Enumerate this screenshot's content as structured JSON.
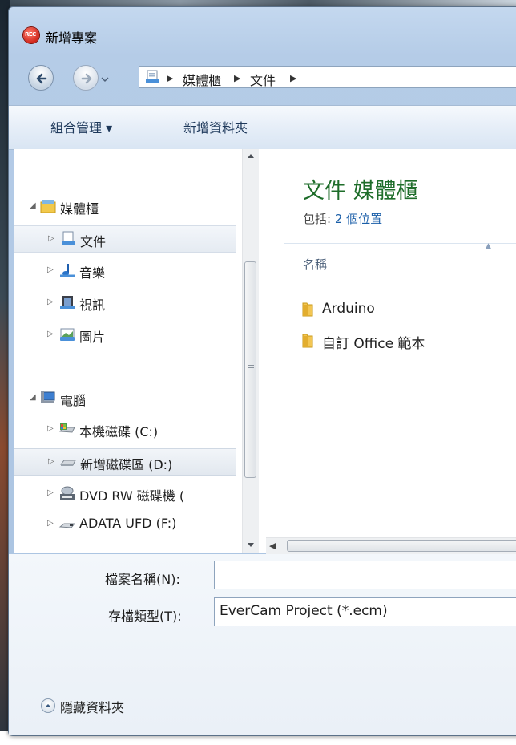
{
  "window": {
    "title": "新增專案",
    "app_badge": "REC"
  },
  "address": {
    "segments": [
      "媒體櫃",
      "文件"
    ]
  },
  "toolbar": {
    "organize": "組合管理 ▾",
    "new_folder": "新增資料夾"
  },
  "nav": {
    "items": [
      {
        "label": "媒體櫃",
        "icon": "library-icon"
      },
      {
        "label": "文件",
        "icon": "documents-icon"
      },
      {
        "label": "音樂",
        "icon": "music-icon"
      },
      {
        "label": "視訊",
        "icon": "video-icon"
      },
      {
        "label": "圖片",
        "icon": "pictures-icon"
      },
      {
        "label": "電腦",
        "icon": "computer-icon"
      },
      {
        "label": "本機磁碟 (C:)",
        "icon": "drive-icon"
      },
      {
        "label": "新增磁碟區 (D:)",
        "icon": "drive-icon"
      },
      {
        "label": "DVD RW 磁碟機 (",
        "icon": "dvd-icon"
      },
      {
        "label": "ADATA UFD (F:)",
        "icon": "usb-drive-icon"
      }
    ]
  },
  "library": {
    "title": "文件 媒體櫃",
    "includes_prefix": "包括: ",
    "includes_link": "2 個位置",
    "column_name": "名稱",
    "files": [
      "Arduino",
      "自訂 Office 範本"
    ]
  },
  "form": {
    "filename_label": "檔案名稱(N):",
    "filename_value": "",
    "filetype_label": "存檔類型(T):",
    "filetype_value": "EverCam Project (*.ecm)"
  },
  "footer": {
    "hide_folders": "隱藏資料夾"
  }
}
